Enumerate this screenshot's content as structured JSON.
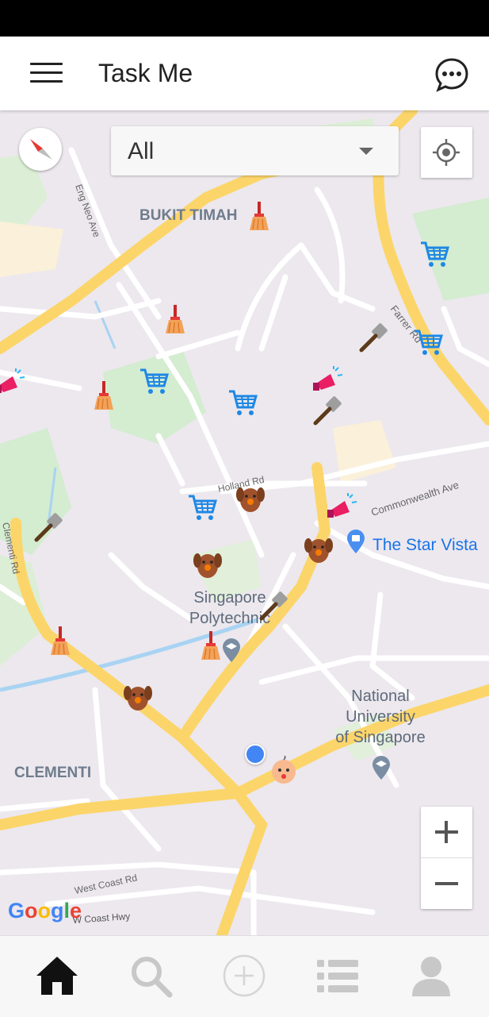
{
  "app": {
    "title": "Task Me"
  },
  "filter": {
    "selected": "All"
  },
  "map": {
    "area_labels": {
      "bukit_timah": "BUKIT TIMAH",
      "clementi": "CLEMENTI"
    },
    "road_labels": {
      "eng_neo_ave": "Eng Neo Ave",
      "farrer_rd": "Farrer Rd",
      "holland_rd": "Holland Rd",
      "commonwealth_ave": "Commonwealth Ave",
      "clementi_rd": "Clementi Rd",
      "west_coast_rd": "West Coast Rd",
      "w_coast_hwy": "W Coast Hwy"
    },
    "places": {
      "star_vista": "The Star Vista",
      "singapore_poly_line1": "Singapore",
      "singapore_poly_line2": "Polytechnic",
      "nus_line1": "National",
      "nus_line2": "University",
      "nus_line3": "of Singapore"
    },
    "zoom_in": "+",
    "zoom_out": "−",
    "attribution": "Google"
  },
  "icons": {
    "menu": "hamburger-menu-icon",
    "chat": "chat-bubble-icon",
    "locate": "my-location-icon",
    "compass": "compass-icon",
    "markers": [
      "shopping-cart-icon",
      "broom-icon",
      "spatula-icon",
      "megaphone-icon",
      "dog-icon",
      "baby-icon"
    ],
    "nav": [
      "home-icon",
      "search-icon",
      "add-icon",
      "list-icon",
      "profile-icon"
    ]
  },
  "colors": {
    "road_major": "#fcd56a",
    "road_minor": "#ffffff",
    "map_bg": "#ece8ee",
    "park": "#d4ecd0",
    "water": "#a9d3f2",
    "cart_blue": "#1e88e5",
    "user_dot": "#4285f4",
    "nav_active": "#111111",
    "nav_inactive": "#c8c8c8"
  }
}
